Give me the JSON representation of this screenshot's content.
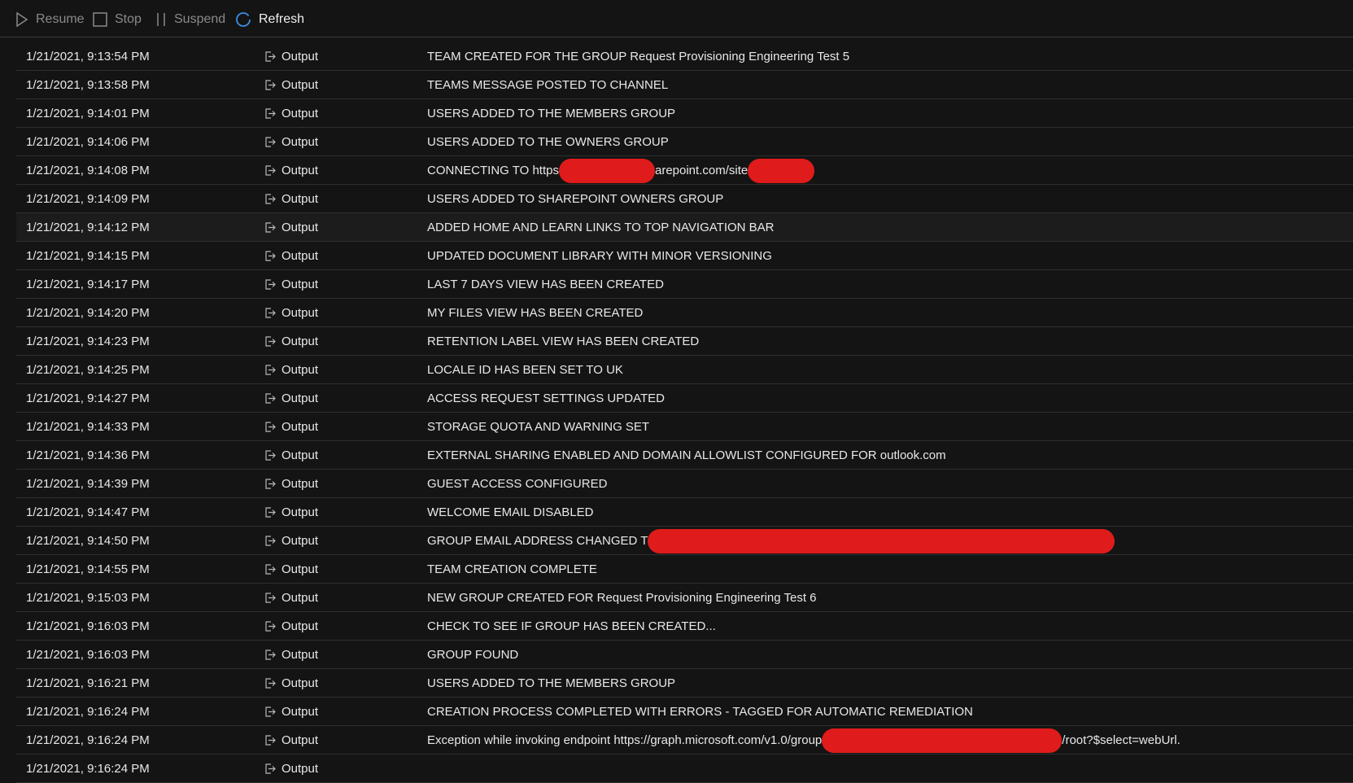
{
  "toolbar": {
    "resume_label": "Resume",
    "stop_label": "Stop",
    "suspend_label": "Suspend",
    "refresh_label": "Refresh",
    "refresh_color": "#3b8ee8"
  },
  "redaction_color": "#e01b1b",
  "rows": [
    {
      "time": "1/21/2021, 9:13:54 PM",
      "type": "Output",
      "msg": "TEAM CREATED FOR THE GROUP Request Provisioning Engineering Test 5"
    },
    {
      "time": "1/21/2021, 9:13:58 PM",
      "type": "Output",
      "msg": "TEAMS MESSAGE POSTED TO CHANNEL"
    },
    {
      "time": "1/21/2021, 9:14:01 PM",
      "type": "Output",
      "msg": "USERS ADDED TO THE MEMBERS GROUP"
    },
    {
      "time": "1/21/2021, 9:14:06 PM",
      "type": "Output",
      "msg": "USERS ADDED TO THE OWNERS GROUP"
    },
    {
      "time": "1/21/2021, 9:14:08 PM",
      "type": "Output",
      "msg_a": "CONNECTING TO https",
      "msg_b": "arepoint.com/site"
    },
    {
      "time": "1/21/2021, 9:14:09 PM",
      "type": "Output",
      "msg": "USERS ADDED TO SHAREPOINT OWNERS GROUP"
    },
    {
      "time": "1/21/2021, 9:14:12 PM",
      "type": "Output",
      "msg": "ADDED HOME AND LEARN LINKS TO TOP NAVIGATION BAR"
    },
    {
      "time": "1/21/2021, 9:14:15 PM",
      "type": "Output",
      "msg": "UPDATED DOCUMENT LIBRARY WITH MINOR VERSIONING"
    },
    {
      "time": "1/21/2021, 9:14:17 PM",
      "type": "Output",
      "msg": "LAST 7 DAYS VIEW HAS BEEN CREATED"
    },
    {
      "time": "1/21/2021, 9:14:20 PM",
      "type": "Output",
      "msg": "MY FILES VIEW HAS BEEN CREATED"
    },
    {
      "time": "1/21/2021, 9:14:23 PM",
      "type": "Output",
      "msg": "RETENTION LABEL VIEW HAS BEEN CREATED"
    },
    {
      "time": "1/21/2021, 9:14:25 PM",
      "type": "Output",
      "msg": "LOCALE ID HAS BEEN SET TO UK"
    },
    {
      "time": "1/21/2021, 9:14:27 PM",
      "type": "Output",
      "msg": "ACCESS REQUEST SETTINGS UPDATED"
    },
    {
      "time": "1/21/2021, 9:14:33 PM",
      "type": "Output",
      "msg": "STORAGE QUOTA AND WARNING SET"
    },
    {
      "time": "1/21/2021, 9:14:36 PM",
      "type": "Output",
      "msg": "EXTERNAL SHARING ENABLED AND DOMAIN ALLOWLIST CONFIGURED FOR outlook.com"
    },
    {
      "time": "1/21/2021, 9:14:39 PM",
      "type": "Output",
      "msg": "GUEST ACCESS CONFIGURED"
    },
    {
      "time": "1/21/2021, 9:14:47 PM",
      "type": "Output",
      "msg": "WELCOME EMAIL DISABLED"
    },
    {
      "time": "1/21/2021, 9:14:50 PM",
      "type": "Output",
      "msg_a": "GROUP EMAIL ADDRESS CHANGED T"
    },
    {
      "time": "1/21/2021, 9:14:55 PM",
      "type": "Output",
      "msg": "TEAM CREATION COMPLETE"
    },
    {
      "time": "1/21/2021, 9:15:03 PM",
      "type": "Output",
      "msg": "NEW GROUP CREATED FOR Request Provisioning Engineering Test 6"
    },
    {
      "time": "1/21/2021, 9:16:03 PM",
      "type": "Output",
      "msg": "CHECK TO SEE IF GROUP HAS BEEN CREATED..."
    },
    {
      "time": "1/21/2021, 9:16:03 PM",
      "type": "Output",
      "msg": "GROUP FOUND"
    },
    {
      "time": "1/21/2021, 9:16:21 PM",
      "type": "Output",
      "msg": "USERS ADDED TO THE MEMBERS GROUP"
    },
    {
      "time": "1/21/2021, 9:16:24 PM",
      "type": "Output",
      "msg": "CREATION PROCESS COMPLETED WITH ERRORS - TAGGED FOR AUTOMATIC REMEDIATION"
    },
    {
      "time": "1/21/2021, 9:16:24 PM",
      "type": "Output",
      "msg_a": "Exception while invoking endpoint https://graph.microsoft.com/v1.0/group",
      "msg_b": "/root?$select=webUrl."
    },
    {
      "time": "1/21/2021, 9:16:24 PM",
      "type": "Output",
      "msg": ""
    }
  ]
}
